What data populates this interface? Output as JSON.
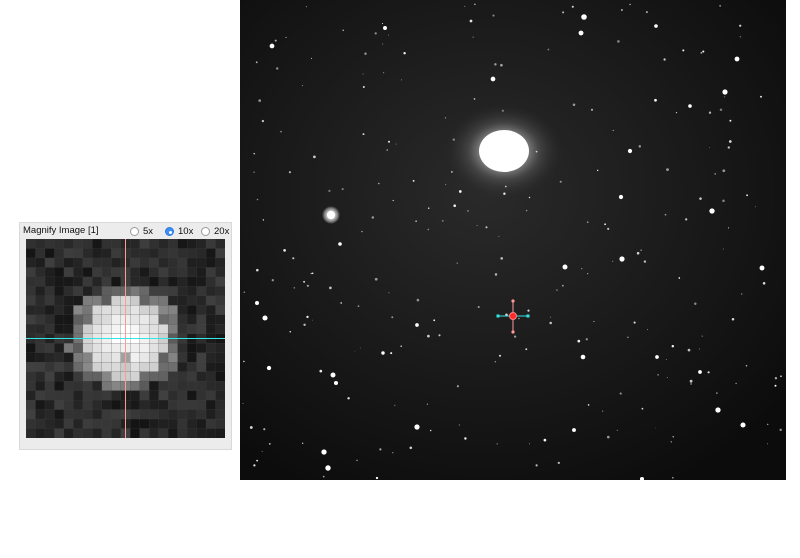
{
  "magnifier": {
    "title": "Magnify Image [1]",
    "zoom_options": [
      {
        "label": "5x",
        "selected": false
      },
      {
        "label": "10x",
        "selected": true
      },
      {
        "label": "20x",
        "selected": false
      }
    ],
    "crosshair_colors": {
      "vertical": "#ff9a9a",
      "horizontal": "#33e6e6"
    }
  },
  "main_image": {
    "marker_colors": {
      "center": "#ff2a2a",
      "horizontal": "#33e6e6",
      "vertical": "#ff9a9a"
    }
  }
}
